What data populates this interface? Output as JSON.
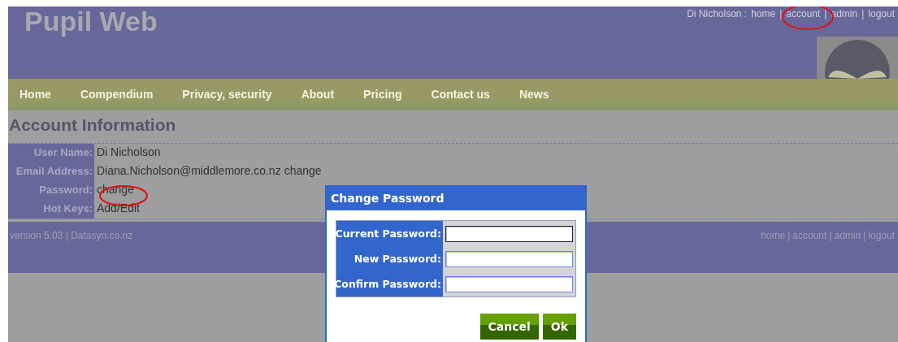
{
  "header": {
    "title": "Pupil Web",
    "user": "Di Nicholson :",
    "separator": "|",
    "links": [
      "home",
      "account",
      "admin",
      "logout"
    ]
  },
  "nav": [
    "Home",
    "Compendium",
    "Privacy, security",
    "About",
    "Pricing",
    "Contact us",
    "News"
  ],
  "account": {
    "heading": "Account Information",
    "rows": [
      {
        "label": "User Name:",
        "value": "Di Nicholson"
      },
      {
        "label": "Email Address:",
        "value": "Diana.Nicholson@middlemore.co.nz",
        "link": "change"
      },
      {
        "label": "Password:",
        "link": "change"
      },
      {
        "label": "Hot Keys:",
        "link": "Add/Edit"
      }
    ]
  },
  "footer": {
    "version": "version 5.03 | Datasyn.co.nz",
    "separator": "|",
    "links": [
      "home",
      "account",
      "admin",
      "logout"
    ]
  },
  "dialog": {
    "title": "Change Password",
    "fields": [
      {
        "label": "Current Password:",
        "focused": true
      },
      {
        "label": "New Password:",
        "focused": false
      },
      {
        "label": "Confirm Password:",
        "focused": false
      }
    ],
    "buttons": [
      "Cancel",
      "Ok"
    ]
  },
  "annotations": [
    {
      "kind": "ellipse"
    },
    {
      "kind": "ellipse"
    }
  ]
}
